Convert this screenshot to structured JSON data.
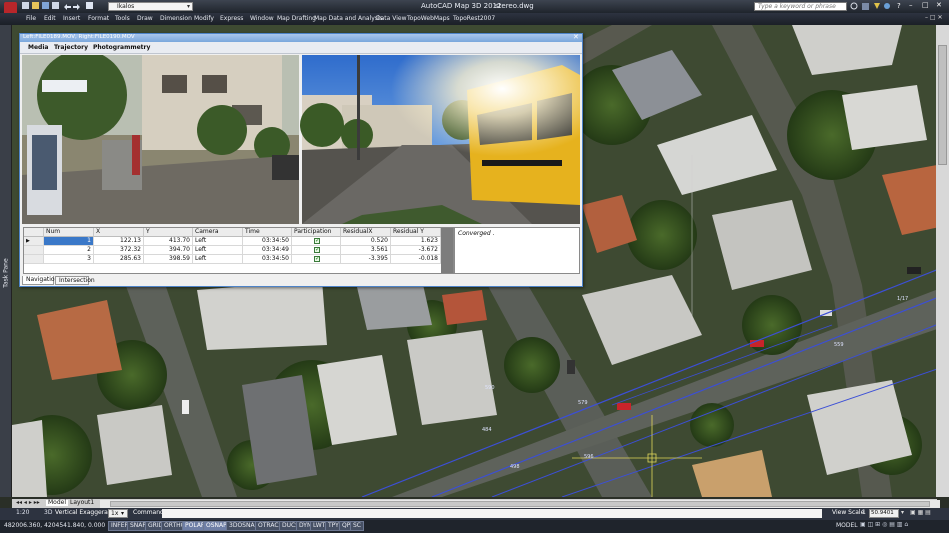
{
  "app": {
    "title": "AutoCAD Map 3D 2012",
    "document": "stereo.dwg",
    "workspace": "Ikalos",
    "search_placeholder": "Type a keyword or phrase"
  },
  "menu": [
    "File",
    "Edit",
    "Insert",
    "Format",
    "Tools",
    "Draw",
    "Dimension",
    "Modify",
    "Express",
    "Window",
    "Map Drafting",
    "Map Data and Analysis",
    "Data View",
    "TopoWebMaps",
    "TopoRest2007"
  ],
  "task_pane_label": "Task Pane",
  "dialog": {
    "title": "Left:FILE0189.MOV, Right:FILE0190.MOV",
    "menu": [
      "Media",
      "Trajectory",
      "Photogrammetry"
    ],
    "status": "Converged .",
    "tabs": [
      "Navigation",
      "Intersection"
    ],
    "table": {
      "headers": [
        "Num",
        "X",
        "Y",
        "Camera",
        "Time",
        "Participation",
        "ResidualX",
        "Residual Y"
      ],
      "rows": [
        {
          "num": "1",
          "x": "122.13",
          "y": "413.70",
          "camera": "Left",
          "time": "03:34:50",
          "participation": true,
          "rx": "0.520",
          "ry": "1.623"
        },
        {
          "num": "2",
          "x": "372.32",
          "y": "394.70",
          "camera": "Left",
          "time": "03:34:49",
          "participation": true,
          "rx": "3.561",
          "ry": "-3.672"
        },
        {
          "num": "3",
          "x": "285.63",
          "y": "398.59",
          "camera": "Left",
          "time": "03:34:50",
          "participation": true,
          "rx": "-3.395",
          "ry": "-0.018"
        }
      ]
    }
  },
  "map_labels": [
    "590",
    "579",
    "484",
    "498",
    "596",
    "1/17",
    "559"
  ],
  "layout_tabs": [
    "Model",
    "Layout1"
  ],
  "toolstrip": {
    "scale_left": "1:20",
    "mode_3d": "3D",
    "vert_exag_label": "Vertical Exaggeration:",
    "vert_exag_value": "1x",
    "command_label": "Command",
    "view_scale_label": "View Scale",
    "view_scale_value": "1",
    "scale_value": "50.9401"
  },
  "status": {
    "coords": "482006.360, 4204541.840, 0.000",
    "buttons": [
      "INFER",
      "SNAP",
      "GRID",
      "ORTHO",
      "POLAR",
      "OSNAP",
      "3DOSNAP",
      "OTRACK",
      "DUCS",
      "DYN",
      "LWT",
      "TPY",
      "QP",
      "SC"
    ],
    "active": [
      "POLAR",
      "OSNAP"
    ],
    "right": "MODEL"
  },
  "colors": {
    "dialog_title": "#7aa7dc",
    "row_select": "#3a78c8",
    "parcel_line": "#3c4fd6",
    "crosshair": "#e0d65a",
    "app_button": "#b8262a"
  }
}
